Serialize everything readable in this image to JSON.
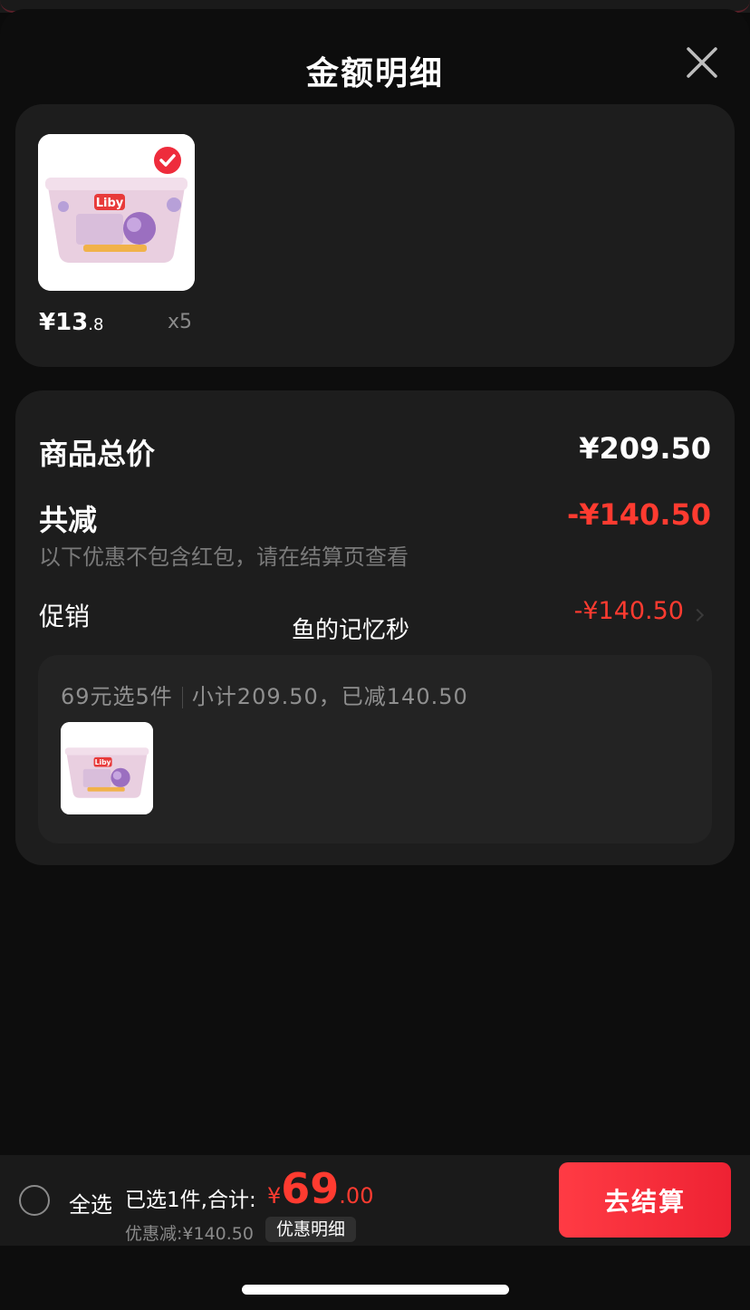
{
  "sheet": {
    "title": "金额明细",
    "close_icon": "close-icon"
  },
  "product": {
    "price_symbol": "¥",
    "price_int": "13",
    "price_dec": ".8",
    "quantity": "x5",
    "selected": true,
    "image_icon": "laundry-pods-box"
  },
  "summary": {
    "total_label": "商品总价",
    "total_value": "¥209.50",
    "reduce_label": "共减",
    "reduce_value": "-¥140.50",
    "note": "以下优惠不包含红包，请在结算页查看",
    "promo_label": "促销",
    "promo_value": "-¥140.50",
    "watermark": "鱼的记忆秒"
  },
  "promo_box": {
    "rule": "69元选5件",
    "detail": "小计209.50，已减140.50"
  },
  "bottom_bar": {
    "select_all": "全选",
    "selected_text": "已选1件,合计:",
    "total_symbol": "¥",
    "total_int": "69",
    "total_dec": ".00",
    "discount": "优惠减:¥140.50",
    "detail_button": "优惠明细",
    "checkout_button": "去结算"
  },
  "colors": {
    "accent_red": "#ff3b30",
    "card_bg": "#1d1d1d",
    "sheet_bg": "#0d0d0d"
  }
}
